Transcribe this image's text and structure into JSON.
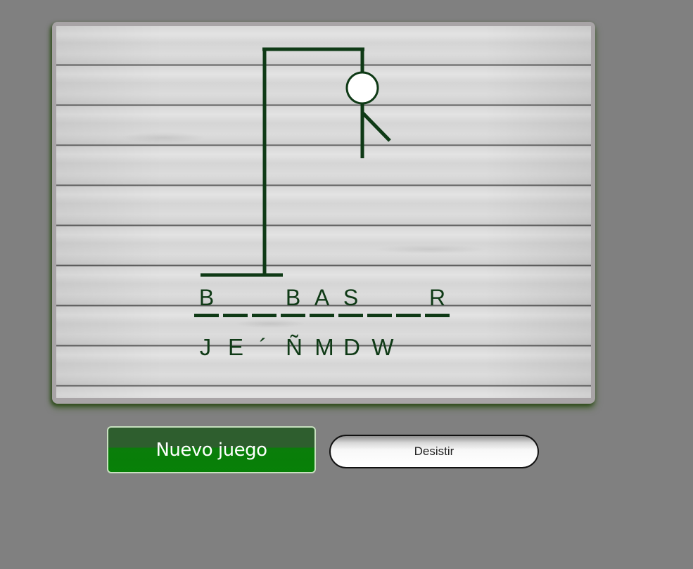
{
  "board": {
    "slots": [
      "B",
      "",
      "",
      "B",
      "A",
      "S",
      "",
      "",
      "R"
    ],
    "wrong_letters": [
      "J",
      "E",
      "´",
      "Ñ",
      "M",
      "D",
      "W"
    ]
  },
  "colors": {
    "ink": "#0f3a16",
    "page_background": "#808080",
    "new_game_button": "#078007"
  },
  "buttons": {
    "new_game_label": "Nuevo juego",
    "quit_label": "Desistir"
  }
}
